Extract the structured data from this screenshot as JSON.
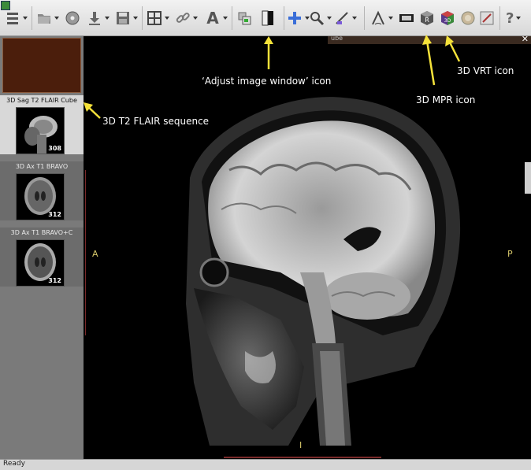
{
  "toolbar": {
    "buttons": [
      {
        "name": "layout-list-button",
        "icon": "list-settings-icon"
      },
      {
        "name": "open-folder-button",
        "icon": "folder-open-icon"
      },
      {
        "name": "cd-disc-button",
        "icon": "disc-icon"
      },
      {
        "name": "download-button",
        "icon": "download-arrow-icon"
      },
      {
        "name": "save-button",
        "icon": "floppy-disk-icon"
      },
      {
        "name": "grid-layout-button",
        "icon": "grid-icon"
      },
      {
        "name": "link-button",
        "icon": "link-chain-icon"
      },
      {
        "name": "text-annotation-button",
        "icon": "letter-a-icon",
        "label": "A"
      },
      {
        "name": "copy-image-button",
        "icon": "copy-images-icon"
      },
      {
        "name": "adjust-image-window-button",
        "icon": "contrast-window-icon"
      },
      {
        "name": "pan-button",
        "icon": "move-cross-icon"
      },
      {
        "name": "zoom-button",
        "icon": "magnifier-icon"
      },
      {
        "name": "measure-button",
        "icon": "ruler-measure-icon"
      },
      {
        "name": "angle-button",
        "icon": "angle-icon"
      },
      {
        "name": "film-button",
        "icon": "film-strip-icon"
      },
      {
        "name": "3d-mpr-button",
        "icon": "mpr-cube-icon",
        "label": "R"
      },
      {
        "name": "3d-vrt-button",
        "icon": "vrt-cube-icon",
        "label": "3D"
      },
      {
        "name": "sync-button",
        "icon": "sync-circle-icon"
      },
      {
        "name": "tools-button",
        "icon": "tools-icon"
      },
      {
        "name": "help-button",
        "icon": "help-question-icon",
        "label": "?"
      }
    ]
  },
  "series": [
    {
      "label": "3D Sag T2 FLAIR Cube",
      "count": "308",
      "selected": true
    },
    {
      "label": "3D Ax T1 BRAVO",
      "count": "312",
      "selected": false
    },
    {
      "label": "3D Ax T1 BRAVO+C",
      "count": "312",
      "selected": false
    }
  ],
  "viewer": {
    "tab_title_fragment": "ube",
    "orientation": {
      "left": "A",
      "right": "P",
      "bottom": "I"
    }
  },
  "annotations": {
    "adjust_window": "‘Adjust image window’ icon",
    "flair_sequence": "3D T2 FLAIR sequence",
    "mpr": "3D MPR icon",
    "vrt": "3D VRT icon"
  },
  "status": {
    "text": "Ready"
  },
  "colors": {
    "annotation_arrow": "#f5e23a",
    "orientation_text": "#d6c76a",
    "swatch": "#4b1e0c"
  }
}
